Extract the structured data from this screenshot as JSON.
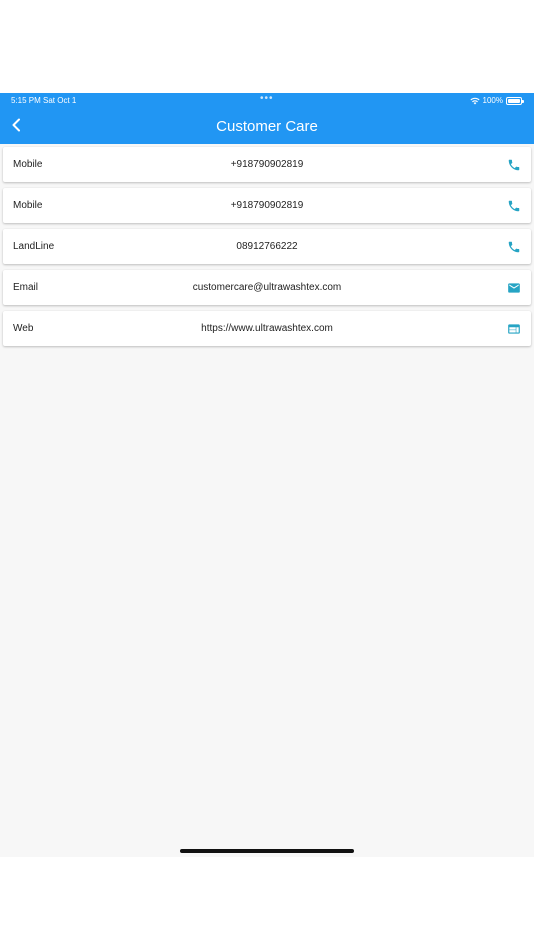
{
  "status_bar": {
    "time": "5:15 PM  Sat Oct 1",
    "dots": "•••",
    "battery": "100%"
  },
  "app_bar": {
    "title": "Customer Care"
  },
  "contacts": [
    {
      "label": "Mobile",
      "value": "+918790902819",
      "icon": "phone-icon"
    },
    {
      "label": "Mobile",
      "value": "+918790902819",
      "icon": "phone-icon"
    },
    {
      "label": "LandLine",
      "value": "08912766222",
      "icon": "phone-icon"
    },
    {
      "label": "Email",
      "value": "customercare@ultrawashtex.com",
      "icon": "mail-icon"
    },
    {
      "label": "Web",
      "value": "https://www.ultrawashtex.com",
      "icon": "web-icon"
    }
  ],
  "colors": {
    "app_bar": "#2196f3",
    "icon_accent": "#26a4c4",
    "background": "#f7f7f7"
  }
}
